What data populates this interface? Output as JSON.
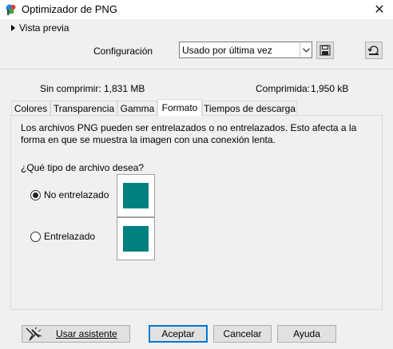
{
  "window": {
    "title": "Optimizador de PNG",
    "close_glyph": "✕"
  },
  "preview": {
    "label": "Vista previa"
  },
  "config": {
    "label": "Configuración",
    "selected": "Usado por última vez"
  },
  "sizes": {
    "uncompressed_label": "Sin comprimir:",
    "uncompressed_value": "1,831 MB",
    "compressed_label": "Comprimida:",
    "compressed_value": "1,950 kB"
  },
  "tabs": [
    {
      "label": "Colores",
      "active": false
    },
    {
      "label": "Transparencia",
      "active": false
    },
    {
      "label": "Gamma",
      "active": false
    },
    {
      "label": "Formato",
      "active": true
    },
    {
      "label": "Tiempos de descarga",
      "active": false
    }
  ],
  "format": {
    "description": "Los archivos PNG pueden ser entrelazados o no entrelazados. Esto afecta a la forma en que se muestra la imagen con una conexión lenta.",
    "question": "¿Qué tipo de archivo desea?",
    "options": [
      {
        "label": "No entrelazado",
        "selected": true
      },
      {
        "label": "Entrelazado",
        "selected": false
      }
    ],
    "thumb_color": "#008080"
  },
  "buttons": {
    "wizard": "Usar asistente",
    "ok": "Aceptar",
    "cancel": "Cancelar",
    "help": "Ayuda"
  },
  "icons": {
    "app": "paintshop-logo-icon",
    "save": "floppy-disk-icon",
    "reset": "reset-preset-icon",
    "wizard": "magic-wand-icon"
  }
}
